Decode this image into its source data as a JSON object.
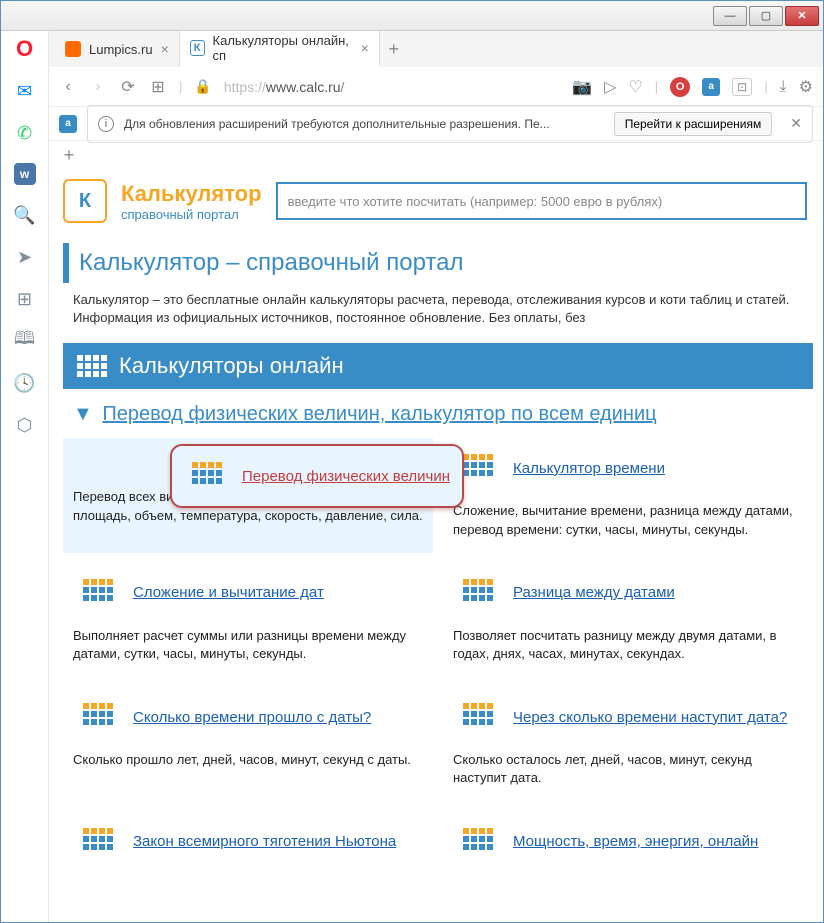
{
  "window": {
    "minimize": "—",
    "maximize": "▢",
    "close": "✕"
  },
  "tabs": [
    {
      "label": "Lumpics.ru",
      "favicon_bg": "#ff6a00",
      "favicon_text": ""
    },
    {
      "label": "Калькуляторы онлайн, сп",
      "favicon_bg": "#fff",
      "favicon_text": "К"
    }
  ],
  "addr": {
    "proto": "https://",
    "domain": "www.calc.ru",
    "path": "/"
  },
  "notif": {
    "text": "Для обновления расширений требуются дополнительные разрешения. Пе...",
    "button": "Перейти к расширениям"
  },
  "site": {
    "logo_top": "Калькулятор",
    "logo_bottom": "справочный портал",
    "search_placeholder": "введите что хотите посчитать (например: 5000 евро в рублях)",
    "h1": "Калькулятор – справочный портал",
    "intro": "Калькулятор – это бесплатные онлайн калькуляторы расчета, перевода, отслеживания курсов и коти таблиц и статей. Информация из официальных источников, постоянное обновление. Без оплаты, без",
    "section": "Калькуляторы онлайн",
    "sub_h": "Перевод физических величин, калькулятор по всем единиц"
  },
  "cards": [
    {
      "title": "Перевод физических величин",
      "desc": "Перевод всех видов физических величин: длина, площадь, объем, температура, скорость, давление, сила.",
      "highlighted": true
    },
    {
      "title": "Калькулятор времени",
      "desc": "Сложение, вычитание времени, разница между датами, перевод времени: сутки, часы, минуты, секунды."
    },
    {
      "title": "Сложение и вычитание дат",
      "desc": "Выполняет расчет суммы или разницы времени между датами, сутки, часы, минуты, секунды."
    },
    {
      "title": "Разница между датами",
      "desc": "Позволяет посчитать разницу между двумя датами, в годах, днях, часах, минутах, секундах."
    },
    {
      "title": "Сколько времени прошло с даты?",
      "desc": "Сколько прошло лет, дней, часов, минут, секунд с даты."
    },
    {
      "title": "Через сколько времени наступит дата?",
      "desc": "Сколько осталось лет, дней, часов, минут, секунд наступит дата."
    },
    {
      "title": "Закон всемирного тяготения Ньютона",
      "desc": ""
    },
    {
      "title": "Мощность, время, энергия, онлайн",
      "desc": ""
    }
  ]
}
